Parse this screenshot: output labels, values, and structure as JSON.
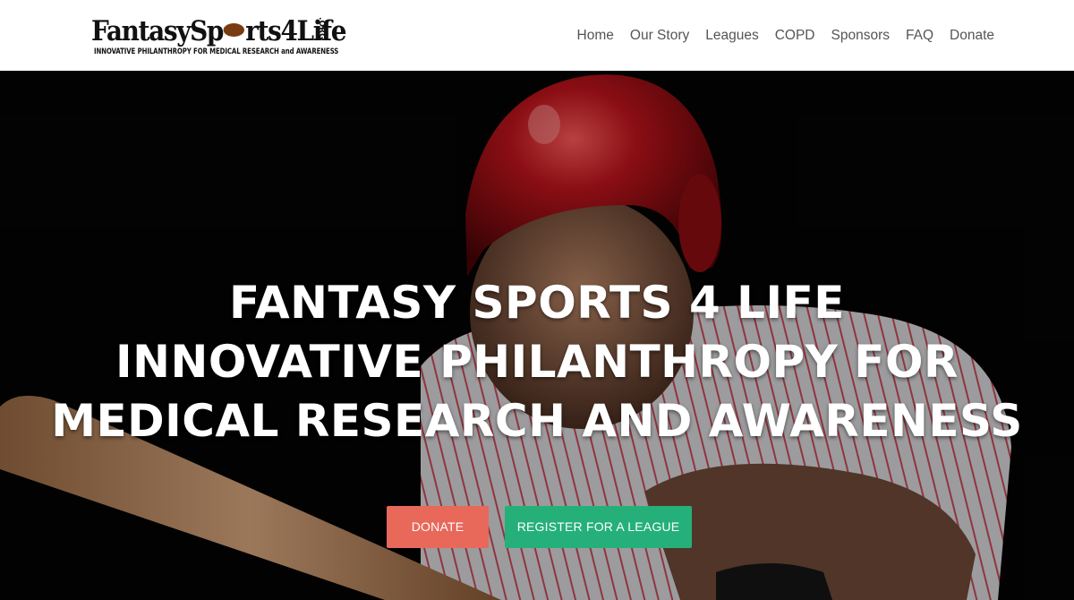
{
  "header": {
    "logo_title_a": "FantasySp",
    "logo_title_b": "rts4Life",
    "logo_org": ".ORG",
    "logo_tagline": "INNOVATIVE PHILANTHROPY FOR MEDICAL RESEARCH and AWARENESS",
    "nav": [
      "Home",
      "Our Story",
      "Leagues",
      "COPD",
      "Sponsors",
      "FAQ",
      "Donate"
    ]
  },
  "hero": {
    "headline": [
      "FANTASY SPORTS 4 LIFE",
      "INNOVATIVE PHILANTHROPY FOR",
      "MEDICAL RESEARCH AND AWARENESS"
    ],
    "donate_label": "DONATE",
    "register_label": "REGISTER FOR A LEAGUE"
  },
  "colors": {
    "donate_button": "#e8685a",
    "register_button": "#25b07a",
    "helmet": "#c0141c"
  },
  "icons": [
    "football-icon"
  ]
}
